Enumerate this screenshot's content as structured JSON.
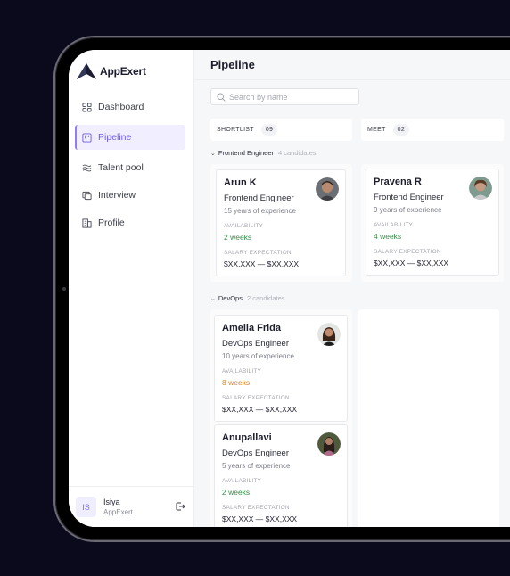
{
  "app": {
    "name": "AppExert"
  },
  "sidebar": {
    "items": [
      {
        "label": "Dashboard",
        "icon": "grid-icon",
        "active": false
      },
      {
        "label": "Pipeline",
        "icon": "kanban-icon",
        "active": true
      },
      {
        "label": "Talent pool",
        "icon": "waves-icon",
        "active": false
      },
      {
        "label": "Interview",
        "icon": "chat-icon",
        "active": false
      },
      {
        "label": "Profile",
        "icon": "building-icon",
        "active": false
      }
    ],
    "user": {
      "initials": "IS",
      "name": "Isiya",
      "org": "AppExert",
      "logout_icon": "logout-icon"
    }
  },
  "main": {
    "title": "Pipeline",
    "search": {
      "placeholder": "Search by name",
      "value": ""
    },
    "columns": [
      {
        "label": "SHORTLIST",
        "count": "09"
      },
      {
        "label": "MEET",
        "count": "02"
      }
    ],
    "groups": [
      {
        "label": "Frontend Engineer",
        "count_text": "4 candidates"
      },
      {
        "label": "DevOps",
        "count_text": "2 candidates"
      }
    ],
    "colors": {
      "green": "#3a8a4a",
      "orange": "#d9822b",
      "accent": "#6c5ce7"
    },
    "cards": [
      {
        "name": "Arun K",
        "role": "Frontend Engineer",
        "experience": "15 years of experience",
        "availability_label": "AVAILABILITY",
        "availability": "2 weeks",
        "availability_status": "green",
        "salary_label": "SALARY EXPECTATION",
        "salary": "$XX,XXX — $XX,XXX"
      },
      {
        "name": "Pravena R",
        "role": "Frontend Engineer",
        "experience": "9 years of experience",
        "availability_label": "AVAILABILITY",
        "availability": "4 weeks",
        "availability_status": "green",
        "salary_label": "SALARY EXPECTATION",
        "salary": "$XX,XXX — $XX,XXX"
      },
      {
        "name": "Amelia Frida",
        "role": "DevOps Engineer",
        "experience": "10 years of experience",
        "availability_label": "AVAILABILITY",
        "availability": "8 weeks",
        "availability_status": "orange",
        "salary_label": "SALARY EXPECTATION",
        "salary": "$XX,XXX — $XX,XXX"
      },
      {
        "name": "Anupallavi",
        "role": "DevOps Engineer",
        "experience": "5 years of experience",
        "availability_label": "AVAILABILITY",
        "availability": "2 weeks",
        "availability_status": "green",
        "salary_label": "SALARY EXPECTATION",
        "salary": "$XX,XXX — $XX,XXX"
      }
    ]
  }
}
